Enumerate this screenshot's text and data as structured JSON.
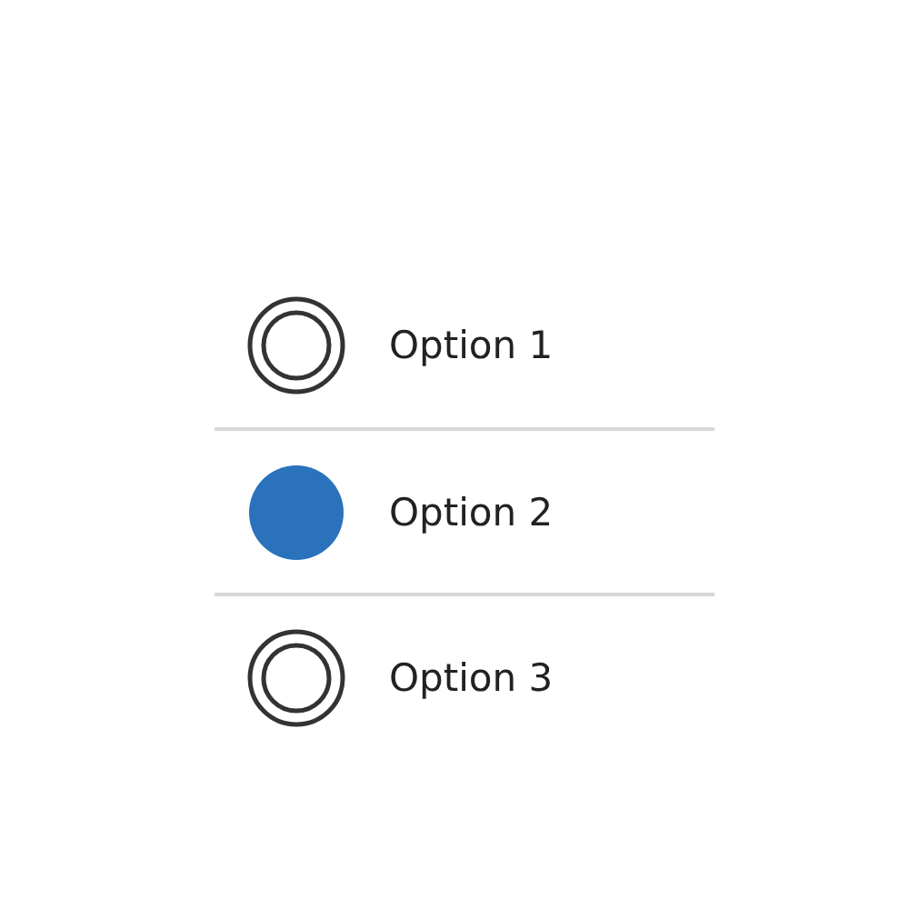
{
  "options": [
    {
      "label": "Option 1",
      "selected": false
    },
    {
      "label": "Option 2",
      "selected": true
    },
    {
      "label": "Option 3",
      "selected": false
    }
  ]
}
